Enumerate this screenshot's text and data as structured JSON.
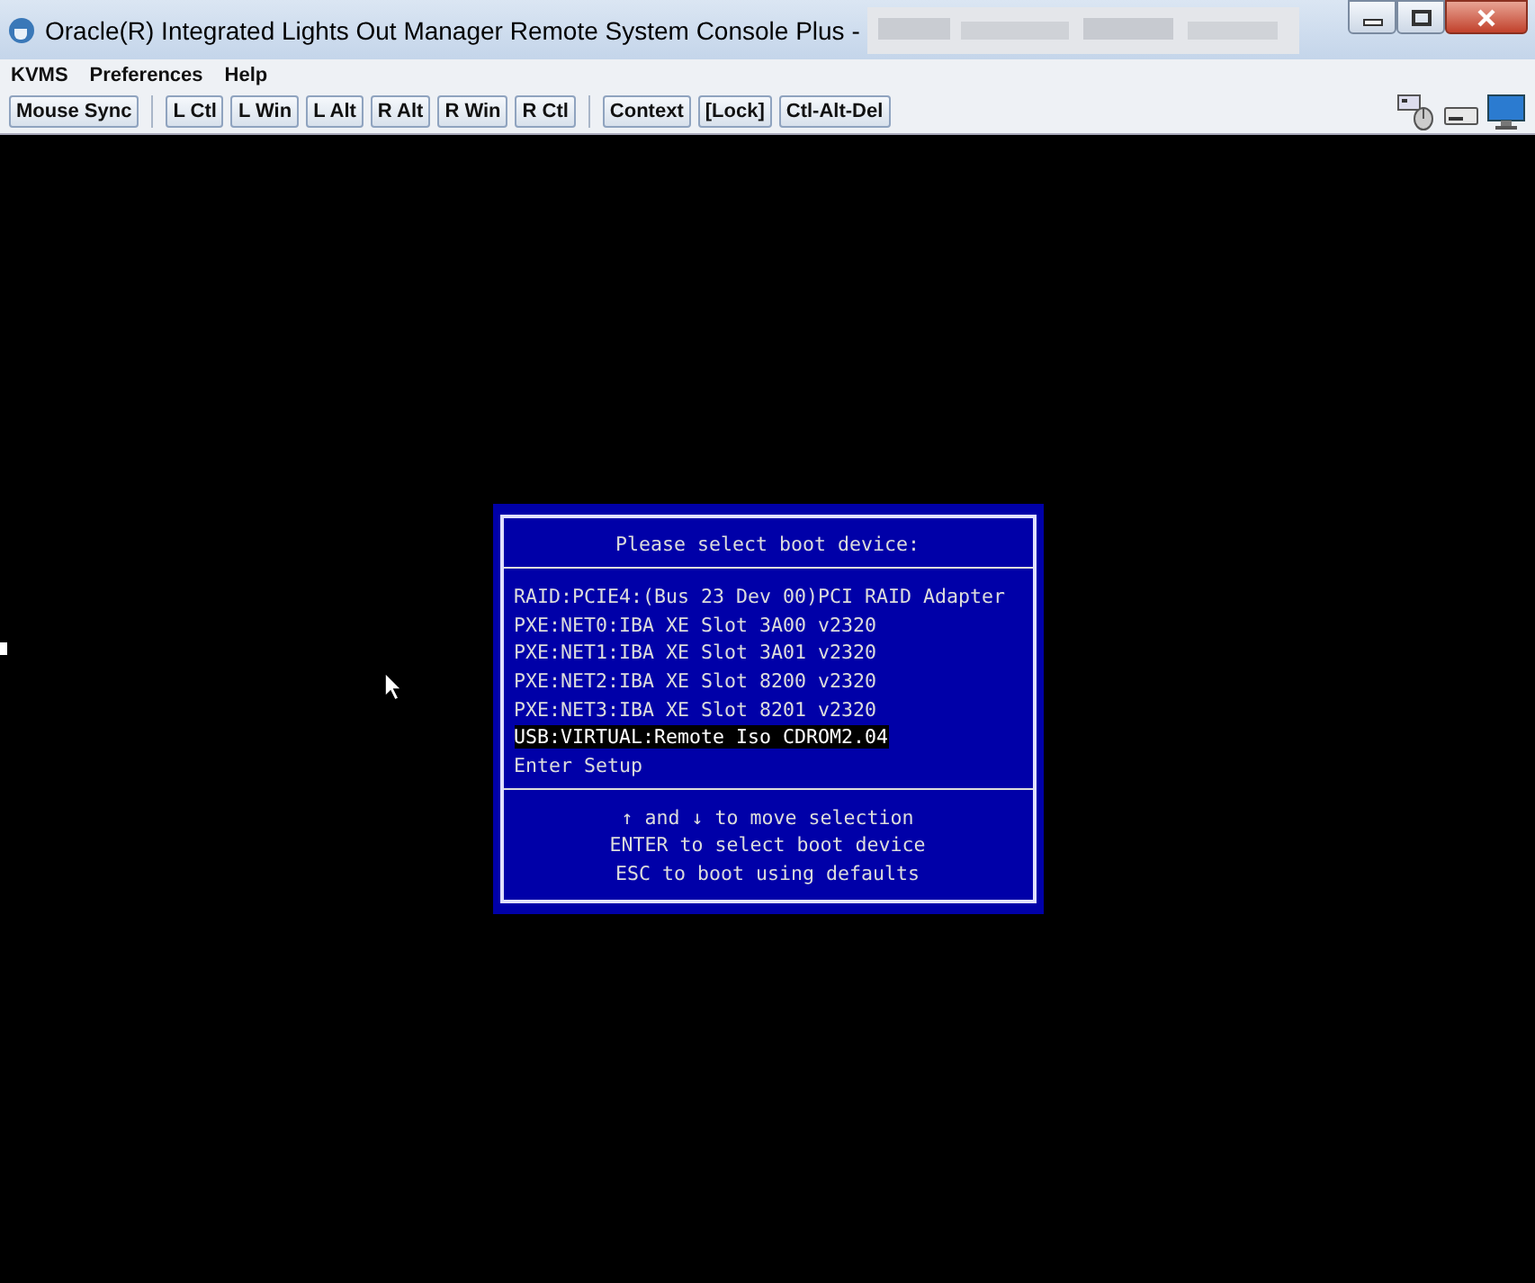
{
  "window": {
    "title": "Oracle(R) Integrated Lights Out Manager Remote System Console Plus -"
  },
  "menu": [
    "KVMS",
    "Preferences",
    "Help"
  ],
  "toolbar": {
    "groups": [
      [
        "Mouse Sync"
      ],
      [
        "L Ctl",
        "L Win",
        "L Alt",
        "R Alt",
        "R Win",
        "R Ctl"
      ],
      [
        "Context",
        "[Lock]",
        "Ctl-Alt-Del"
      ]
    ]
  },
  "boot_menu": {
    "title": "Please select boot device:",
    "items": [
      {
        "label": "RAID:PCIE4:(Bus 23 Dev 00)PCI RAID Adapter",
        "selected": false
      },
      {
        "label": "PXE:NET0:IBA XE Slot 3A00 v2320",
        "selected": false
      },
      {
        "label": "PXE:NET1:IBA XE Slot 3A01 v2320",
        "selected": false
      },
      {
        "label": "PXE:NET2:IBA XE Slot 8200 v2320",
        "selected": false
      },
      {
        "label": "PXE:NET3:IBA XE Slot 8201 v2320",
        "selected": false
      },
      {
        "label": "USB:VIRTUAL:Remote Iso CDROM2.04",
        "selected": true
      },
      {
        "label": "Enter Setup",
        "selected": false
      }
    ],
    "help": [
      "↑ and ↓ to move selection",
      "ENTER to select boot device",
      "ESC to boot using defaults"
    ]
  }
}
